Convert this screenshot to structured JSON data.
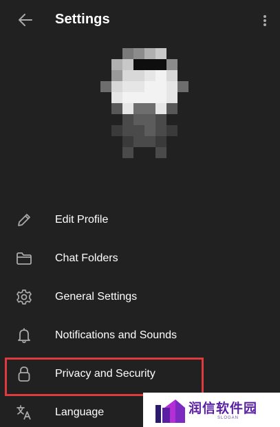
{
  "header": {
    "title": "Settings",
    "back_icon": "arrow-left-icon",
    "more_icon": "more-vertical-icon"
  },
  "menu": [
    {
      "name": "edit-profile",
      "label": "Edit Profile",
      "icon": "pencil-icon"
    },
    {
      "name": "chat-folders",
      "label": "Chat Folders",
      "icon": "folder-icon"
    },
    {
      "name": "general-settings",
      "label": "General Settings",
      "icon": "gear-icon"
    },
    {
      "name": "notifications-and-sounds",
      "label": "Notifications and Sounds",
      "icon": "bell-icon"
    },
    {
      "name": "privacy-and-security",
      "label": "Privacy and Security",
      "icon": "lock-icon"
    },
    {
      "name": "language",
      "label": "Language",
      "icon": "translate-icon"
    }
  ],
  "watermark": {
    "text": "润信软件园",
    "slogan": "SLOGAN"
  },
  "colors": {
    "background": "#212121",
    "text": "#ffffff",
    "icon": "#aaaaaa",
    "highlight": "#e03a3e",
    "watermark_purple": "#5a1fa3"
  }
}
